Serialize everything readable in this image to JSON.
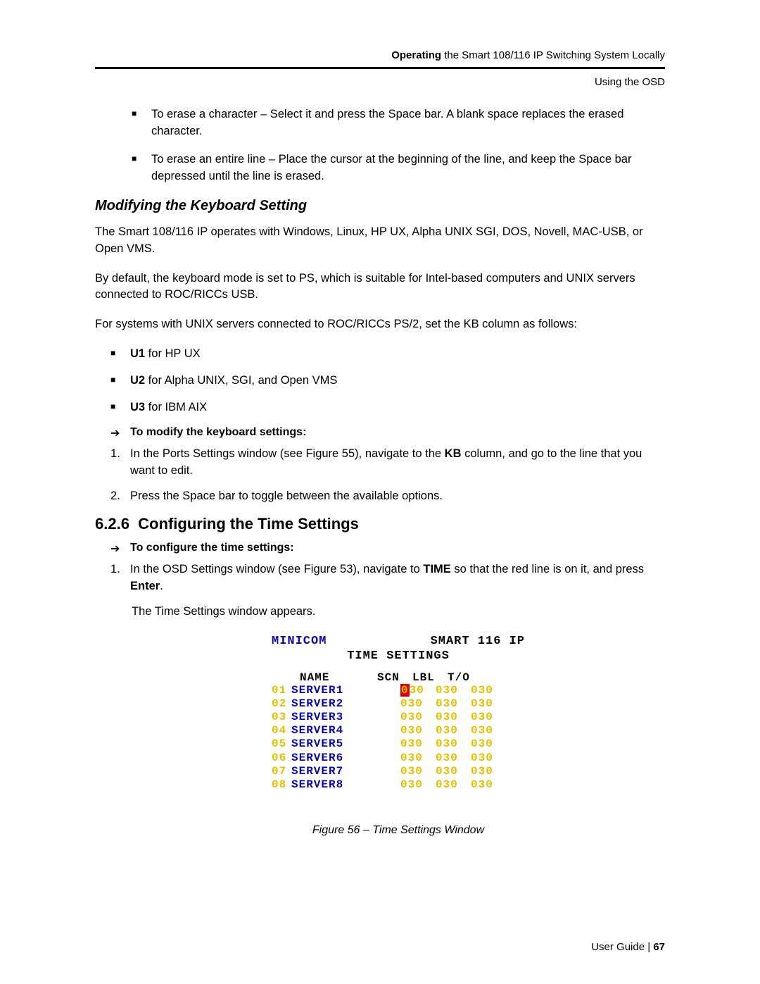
{
  "header": {
    "bold": "Operating",
    "rest": " the Smart 108/116 IP Switching System Locally",
    "sub": "Using the OSD"
  },
  "eraseBullets": [
    "To erase a character – Select it and press the Space bar. A blank space replaces the erased character.",
    "To erase an entire line – Place the cursor at the beginning of the line, and keep the Space bar depressed until the line is erased."
  ],
  "modifyingHeading": "Modifying the Keyboard Setting",
  "para1": "The Smart 108/116 IP operates with Windows, Linux, HP UX, Alpha UNIX SGI, DOS, Novell, MAC-USB, or Open VMS.",
  "para2": "By default, the keyboard mode is set to PS, which is suitable for Intel-based computers and UNIX servers connected to ROC/RICCs USB.",
  "para3": "For systems with UNIX servers connected to ROC/RICCs PS/2, set the KB column as follows:",
  "kb": [
    {
      "bold": "U1",
      "rest": " for HP UX"
    },
    {
      "bold": "U2",
      "rest": " for Alpha UNIX, SGI, and Open VMS"
    },
    {
      "bold": "U3",
      "rest": " for IBM AIX"
    }
  ],
  "modifyArrow": "To modify the keyboard settings:",
  "modifySteps": {
    "s1_a": "In the Ports Settings window (see Figure 55), navigate to the ",
    "s1_bold": "KB",
    "s1_b": " column, and go to the line that you want to edit.",
    "s2": "Press the Space bar to toggle between the available options."
  },
  "sectionNumber": "6.2.6",
  "sectionTitle": "Configuring the Time Settings",
  "timeArrow": "To configure the time settings:",
  "timeStep": {
    "a": "In the OSD Settings window (see Figure 53), navigate to ",
    "bold1": "TIME",
    "b": " so that the red line is on it, and press ",
    "bold2": "Enter",
    "c": "."
  },
  "timeAppears": "The Time Settings window appears.",
  "osd": {
    "brand": "MINICOM",
    "title1": "SMART 116 IP",
    "title2": "TIME SETTINGS",
    "cols": {
      "name": "NAME",
      "scn": "SCN",
      "lbl": "LBL",
      "to": "T/O"
    },
    "rows": [
      {
        "id": "01",
        "name": "SERVER1",
        "scn": "030",
        "lbl": "030",
        "to": "030",
        "hl": true
      },
      {
        "id": "02",
        "name": "SERVER2",
        "scn": "030",
        "lbl": "030",
        "to": "030"
      },
      {
        "id": "03",
        "name": "SERVER3",
        "scn": "030",
        "lbl": "030",
        "to": "030"
      },
      {
        "id": "04",
        "name": "SERVER4",
        "scn": "030",
        "lbl": "030",
        "to": "030"
      },
      {
        "id": "05",
        "name": "SERVER5",
        "scn": "030",
        "lbl": "030",
        "to": "030"
      },
      {
        "id": "06",
        "name": "SERVER6",
        "scn": "030",
        "lbl": "030",
        "to": "030"
      },
      {
        "id": "07",
        "name": "SERVER7",
        "scn": "030",
        "lbl": "030",
        "to": "030"
      },
      {
        "id": "08",
        "name": "SERVER8",
        "scn": "030",
        "lbl": "030",
        "to": "030"
      }
    ]
  },
  "figcap": "Figure 56 – Time Settings Window",
  "footer": {
    "label": "User Guide | ",
    "page": "67"
  }
}
